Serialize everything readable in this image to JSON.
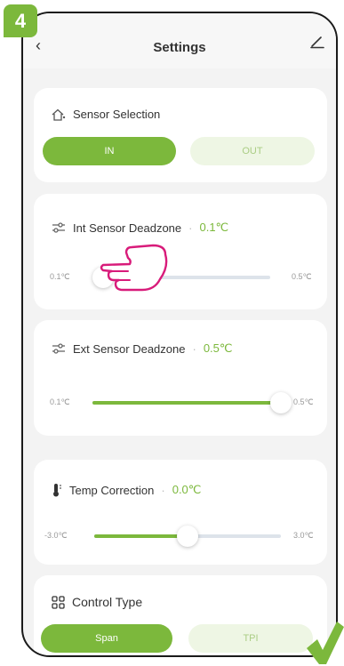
{
  "step_badge": "4",
  "header": {
    "title": "Settings",
    "back_icon": "chevron-left-icon",
    "edit_icon": "pencil-icon"
  },
  "sensor_selection": {
    "label": "Sensor Selection",
    "icon": "home-sensor-icon",
    "options": [
      "IN",
      "OUT"
    ],
    "selected": "IN"
  },
  "int_deadzone": {
    "label": "Int Sensor Deadzone",
    "separator": "·",
    "value": "0.1℃",
    "min": "0.1℃",
    "max": "0.5℃",
    "level": 0
  },
  "ext_deadzone": {
    "label": "Ext Sensor Deadzone",
    "separator": "·",
    "value": "0.5℃",
    "min": "0.1℃",
    "max": "0.5℃",
    "level": 1
  },
  "temp_correction": {
    "label": "Temp Correction",
    "separator": "·",
    "value": "0.0℃",
    "min": "-3.0℃",
    "max": "3.0℃",
    "level": 0.5
  },
  "control_type": {
    "label": "Control Type",
    "icon": "grid-icon",
    "options": [
      "Span",
      "TPI"
    ],
    "selected": "Span"
  },
  "colors": {
    "accent": "#7cb83c",
    "annotation": "#d81b7a"
  }
}
